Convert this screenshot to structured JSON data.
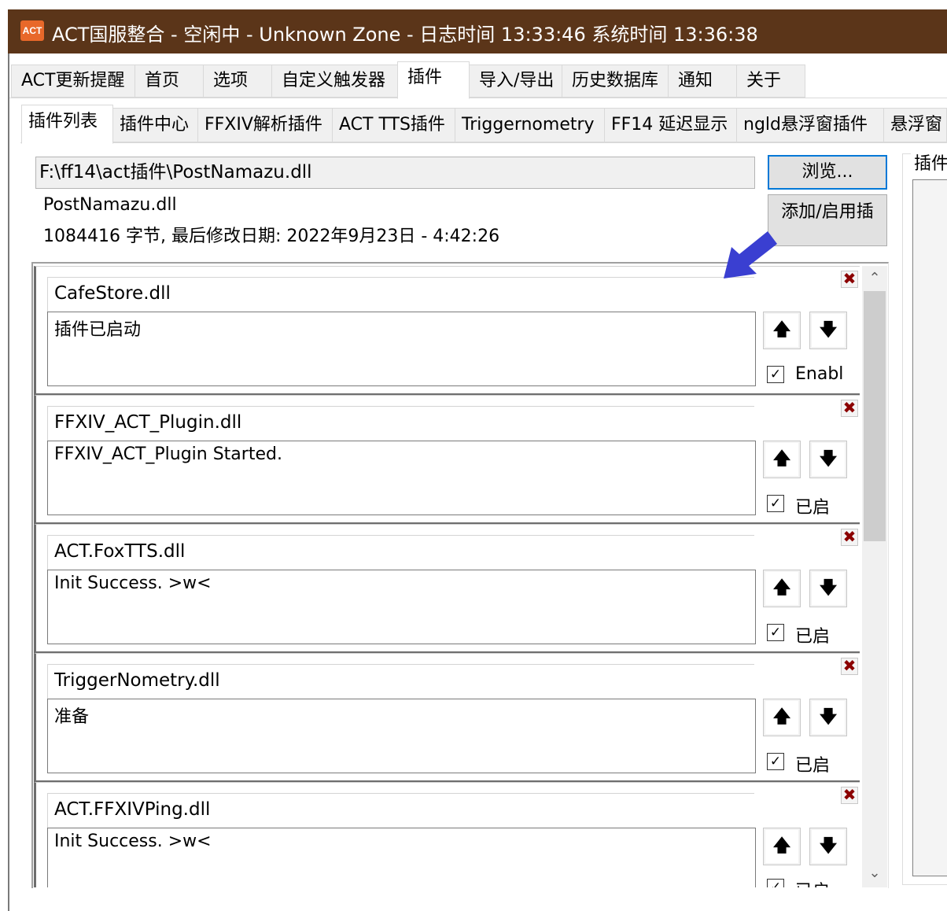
{
  "window": {
    "icon_text": "ACT",
    "title": "ACT国服整合 - 空闲中 - Unknown Zone - 日志时间 13:33:46 系统时间 13:36:38"
  },
  "main_tabs": [
    "ACT更新提醒",
    "首页",
    "选项",
    "自定义触发器",
    "插件",
    "导入/导出",
    "历史数据库",
    "通知",
    "关于"
  ],
  "active_main_tab": "插件",
  "plugin_tabs": [
    "插件列表",
    "插件中心",
    "FFXIV解析插件",
    "ACT TTS插件",
    "Triggernometry",
    "FF14 延迟显示",
    "ngld悬浮窗插件",
    "悬浮窗"
  ],
  "active_plugin_tab": "插件列表",
  "selected_file": {
    "path": "F:\\ff14\\act插件\\PostNamazu.dll",
    "name": "PostNamazu.dll",
    "details": "1084416 字节, 最后修改日期: 2022年9月23日 - 4:42:26"
  },
  "buttons": {
    "browse": "浏览...",
    "add_enable": "添加/启用插"
  },
  "side_panel": {
    "label": "插件"
  },
  "plugins": [
    {
      "file": "CafeStore.dll",
      "status": "插件已启动",
      "enabled_label": "Enabl",
      "enabled": true
    },
    {
      "file": "FFXIV_ACT_Plugin.dll",
      "status": "FFXIV_ACT_Plugin Started.",
      "enabled_label": "已启",
      "enabled": true
    },
    {
      "file": "ACT.FoxTTS.dll",
      "status": "Init Success. >w<",
      "enabled_label": "已启",
      "enabled": true
    },
    {
      "file": "TriggerNometry.dll",
      "status": "准备",
      "enabled_label": "已启",
      "enabled": true
    },
    {
      "file": "ACT.FFXIVPing.dll",
      "status": "Init Success. >w<",
      "enabled_label": "已启",
      "enabled": true
    }
  ],
  "icons": {
    "close": "close-icon",
    "up": "arrow-up-icon",
    "down": "arrow-down-icon",
    "check": "checkbox-icon",
    "pointer": "pointer-arrow-icon"
  },
  "glyphs": {
    "close": "✖",
    "up": "🡅",
    "down": "🡇",
    "check": "✓",
    "scroll_up": "⌃",
    "scroll_down": "⌄"
  },
  "colors": {
    "titlebar": "#5b3519",
    "icon_orange": "#e8682a",
    "close_red": "#8b0000",
    "focus_blue": "#0078d7",
    "pointer_blue": "#3a3fd1"
  }
}
